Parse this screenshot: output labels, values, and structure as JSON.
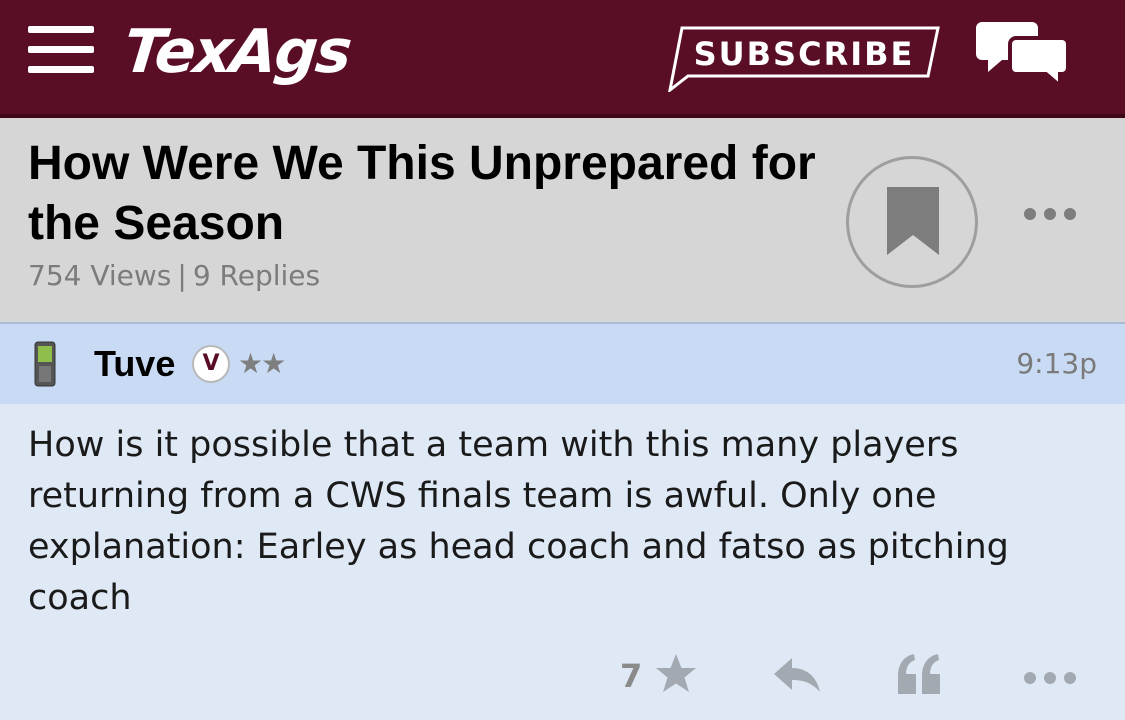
{
  "header": {
    "logo_text": "TexAgs",
    "subscribe_label": "SUBSCRIBE",
    "menu_icon": "hamburger-menu-icon",
    "chat_icon": "chat-bubbles-icon",
    "background_color": "#5a0e26"
  },
  "thread": {
    "title": "How Were We This Unprepared for the Season",
    "views": "754 Views",
    "separator": "|",
    "replies": "9 Replies",
    "bookmark_icon": "bookmark-icon",
    "more_icon": "more-options-icon"
  },
  "post": {
    "device_icon": "mobile-phone-icon",
    "username": "Tuve",
    "badge": "V",
    "stars": "★★",
    "time": "9:13p",
    "body": "How is it possible that a team with this many players returning from a CWS finals team is awful. Only one explanation: Earley as head coach and fatso as pitching coach",
    "actions": {
      "like_count": "7",
      "like_icon": "star-icon",
      "reply_icon": "reply-icon",
      "quote_icon": "quote-icon",
      "more_icon": "more-options-icon"
    }
  }
}
